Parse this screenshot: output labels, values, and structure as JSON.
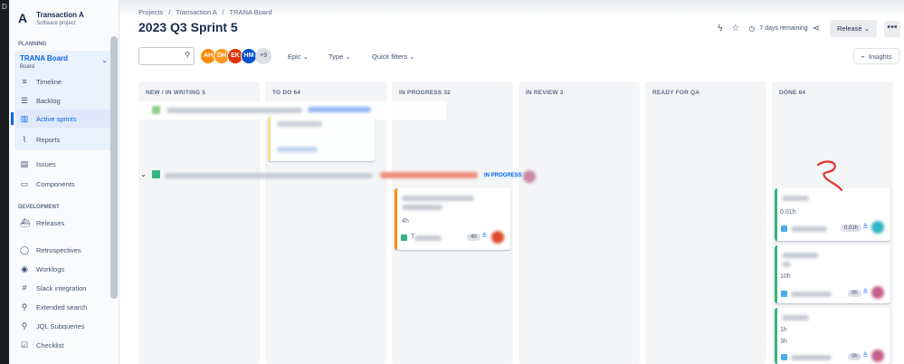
{
  "project": {
    "name": "Transaction A",
    "type": "Software project",
    "logo": "A"
  },
  "sidebar": {
    "planning_label": "PLANNING",
    "board": {
      "name": "TRANA Board",
      "type": "Board"
    },
    "board_items": [
      {
        "label": "Timeline",
        "icon": "timeline-icon"
      },
      {
        "label": "Backlog",
        "icon": "backlog-icon"
      },
      {
        "label": "Active sprints",
        "icon": "board-columns-icon"
      },
      {
        "label": "Reports",
        "icon": "reports-chart-icon"
      }
    ],
    "items": [
      {
        "label": "Issues",
        "icon": "issues-icon"
      },
      {
        "label": "Components",
        "icon": "components-icon"
      }
    ],
    "development_label": "DEVELOPMENT",
    "dev_items": [
      {
        "label": "Releases",
        "icon": "ship-icon"
      },
      {
        "label": "Retrospectives",
        "icon": "retro-icon"
      },
      {
        "label": "Worklogs",
        "icon": "eye-icon"
      },
      {
        "label": "Slack integration",
        "icon": "slack-icon"
      },
      {
        "label": "Extended search",
        "icon": "extended-search-icon"
      },
      {
        "label": "JQL Subqueries",
        "icon": "jql-icon"
      },
      {
        "label": "Checklist",
        "icon": "checklist-icon"
      }
    ]
  },
  "breadcrumb": {
    "projects": "Projects",
    "project": "Transaction A",
    "board": "TRANA Board",
    "sep": "/"
  },
  "title": "2023 Q3 Sprint 5",
  "header_actions": {
    "days_remaining": "7 days remaining",
    "release_label": "Release",
    "more_label": "•••"
  },
  "filters": {
    "avatars": [
      {
        "initials": "AH",
        "color": "#ff8b00"
      },
      {
        "initials": "DH",
        "color": "#ff991f"
      },
      {
        "initials": "EK",
        "color": "#de350b"
      },
      {
        "initials": "HM",
        "color": "#0052cc"
      }
    ],
    "more_avatars": "+9",
    "epic": "Epic",
    "type": "Type",
    "quick_filters": "Quick filters",
    "insights": "Insights"
  },
  "columns": [
    {
      "label": "NEW / IN WRITING 5"
    },
    {
      "label": "TO DO 64"
    },
    {
      "label": "IN PROGRESS 32"
    },
    {
      "label": "IN REVIEW 3"
    },
    {
      "label": "READY FOR QA"
    },
    {
      "label": "DONE 64"
    }
  ],
  "swimlane": {
    "status": "IN PROGRESS"
  },
  "cards": {
    "inprogress": {
      "estimate": "4h",
      "time_pill": "4h",
      "key_prefix": "T"
    },
    "done1": {
      "estimate": "0.01h",
      "time_pill": "0.01h"
    },
    "done2": {
      "estimate": "10h",
      "time_pill": "0h"
    },
    "done3": {
      "estimate_a": "1h",
      "estimate_b": "3h",
      "time_pill": "0h"
    }
  },
  "colors": {
    "accent": "#0c66e4",
    "in_progress_bar": "#ff8b00",
    "done_bar": "#36b37e",
    "annotation": "#e5322d"
  }
}
